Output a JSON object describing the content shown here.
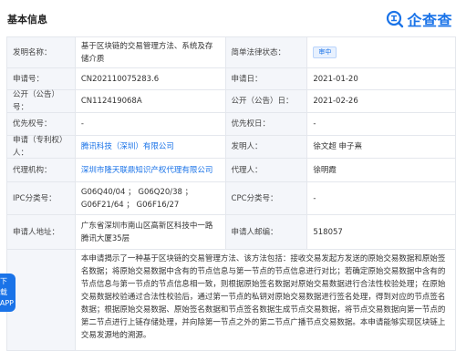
{
  "header": {
    "title": "基本信息"
  },
  "brand": {
    "name": "企查查",
    "logo_icon": "qichacha-logo-icon",
    "color": "#1a73e8"
  },
  "rows": {
    "invention_name": {
      "label": "发明名称：",
      "value": "基于区块链的交易管理方法、系统及存储介质"
    },
    "legal_status": {
      "label": "简单法律状态：",
      "value": "审中"
    },
    "application_no": {
      "label": "申请号：",
      "value": "CN202110075283.6"
    },
    "application_date": {
      "label": "申请日：",
      "value": "2021-01-20"
    },
    "publication_no": {
      "label": "公开（公告）号：",
      "value": "CN112419068A"
    },
    "publication_date": {
      "label": "公开（公告）日：",
      "value": "2021-02-26"
    },
    "priority_no": {
      "label": "优先权号：",
      "value": "-"
    },
    "priority_date": {
      "label": "优先权日：",
      "value": "-"
    },
    "applicant": {
      "label": "申请（专利权）人：",
      "value": "腾讯科技（深圳）有限公司"
    },
    "inventor": {
      "label": "发明人：",
      "value": "徐文超 申子熹"
    },
    "agency": {
      "label": "代理机构：",
      "value": "深圳市隆天联鼎知识产权代理有限公司"
    },
    "agent": {
      "label": "代理人：",
      "value": "徐明霞"
    },
    "ipc": {
      "label": "IPC分类号：",
      "value": "G06Q40/04 ；  G06Q20/38 ；  G06F21/64 ；  G06F16/27"
    },
    "cpc": {
      "label": "CPC分类号：",
      "value": "-"
    },
    "address": {
      "label": "申请人地址：",
      "value": "广东省深圳市南山区高新区科技中一路腾讯大厦35层"
    },
    "postcode": {
      "label": "申请人邮编：",
      "value": "518057"
    },
    "abstract": {
      "label": "",
      "value": "本申请揭示了一种基于区块链的交易管理方法、该方法包括：接收交易发起方发送的原始交易数据和原始签名数据；将原始交易数据中含有的节点信息与第一节点的节点信息进行对比；若确定原始交易数据中含有的节点信息与第一节点的节点信息相一致，则根据原始签名数据对原始交易数据进行合法性校验处理；在原始交易数据校验通过合法性校验后，通过第一节点的私钥对原始交易数据进行签名处理，得到对应的节点签名数据；根据原始交易数据、原始签名数据和节点签名数据生成节点交易数据，将节点交易数据向第一节点的第二节点进行上链存储处理，并向除第一节点之外的第二节点广播节点交易数据。本申请能够实现区块链上交易发源地的溯源。"
    }
  },
  "float_button": {
    "line1": "下载",
    "line2": "APP"
  }
}
